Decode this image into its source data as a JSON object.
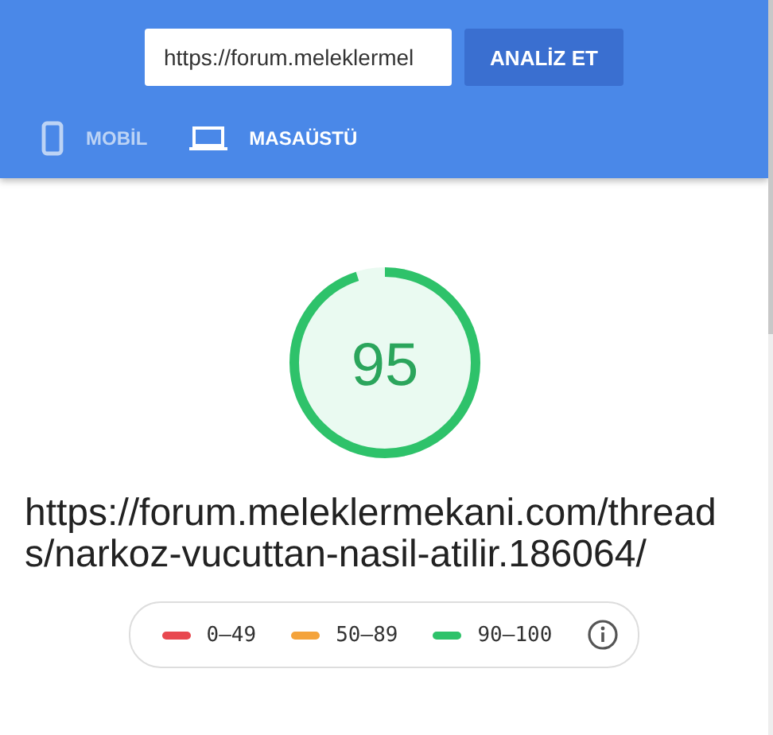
{
  "search": {
    "value": "https://forum.meleklermel",
    "button": "ANALİZ ET"
  },
  "tabs": [
    {
      "label": "MOBİL",
      "kind": "phone",
      "selected": false
    },
    {
      "label": "MASAÜSTÜ",
      "kind": "laptop",
      "selected": true
    }
  ],
  "score": {
    "value": "95",
    "level": 0.95
  },
  "url": "https://forum.meleklermekani.com/threads/narkoz-vucuttan-nasil-atilir.186064/",
  "legend": [
    {
      "label": "0–49",
      "color": "#e8484f"
    },
    {
      "label": "50–89",
      "color": "#f4a33b"
    },
    {
      "label": "90–100",
      "color": "#2ec26a"
    }
  ]
}
